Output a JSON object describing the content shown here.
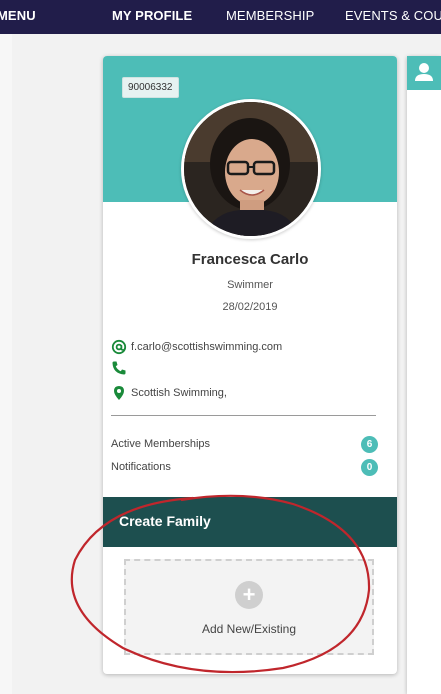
{
  "nav": {
    "menu_label": "MENU",
    "items": [
      {
        "label": "MY PROFILE"
      },
      {
        "label": "MEMBERSHIP"
      },
      {
        "label": "EVENTS & COU"
      }
    ]
  },
  "profile": {
    "member_id": "90006332",
    "name": "Francesca Carlo",
    "role": "Swimmer",
    "date": "28/02/2019",
    "email": "f.carlo@scottishswimming.com",
    "phone": "",
    "location": "Scottish Swimming,",
    "stats": [
      {
        "label": "Active Memberships",
        "count": "6"
      },
      {
        "label": "Notifications",
        "count": "0"
      }
    ]
  },
  "family": {
    "title": "Create Family",
    "add_label": "Add New/Existing"
  },
  "colors": {
    "nav_bg": "#211d4a",
    "accent_teal": "#4dbdb7",
    "dark_teal": "#1d4f4f",
    "icon_green": "#1a8a3a",
    "annotation_red": "#c0262c"
  },
  "icons": {
    "email": "at-icon",
    "phone": "phone-icon",
    "location": "map-pin-icon",
    "add": "plus-icon",
    "right_panel": "user-icon"
  }
}
